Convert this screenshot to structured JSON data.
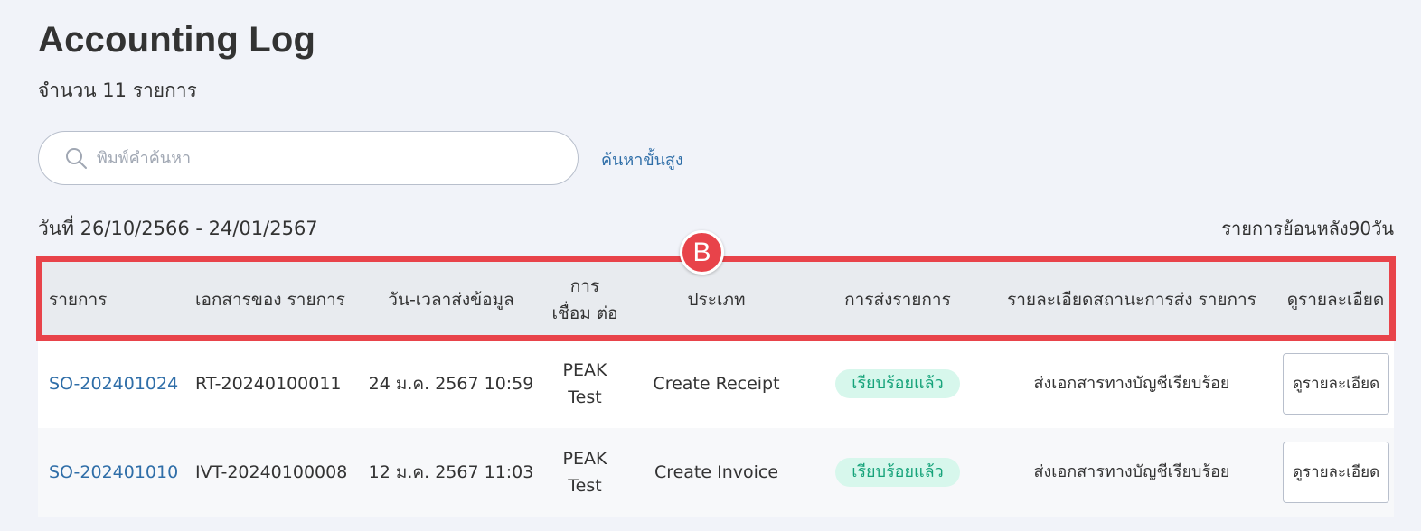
{
  "page": {
    "title": "Accounting Log",
    "count_text": "จำนวน 11 รายการ",
    "search_placeholder": "พิมพ์คำค้นหา",
    "advanced_search": "ค้นหาขั้นสูง",
    "date_range": "วันที่ 26/10/2566 - 24/01/2567",
    "lookback": "รายการย้อนหลัง90วัน"
  },
  "table": {
    "headers": [
      "รายการ",
      "เอกสารของ รายการ",
      "วัน-เวลาส่งข้อมูล",
      "การเชื่อม ต่อ",
      "ประเภท",
      "การส่งรายการ",
      "รายละเอียดสถานะการส่ง รายการ",
      "ดูรายละเอียด"
    ],
    "rows": [
      {
        "order": "SO-202401024",
        "document": "RT-20240100011",
        "datetime": "24 ม.ค. 2567 10:59",
        "connection": "PEAK Test",
        "type": "Create Receipt",
        "status": "เรียบร้อยแล้ว",
        "status_detail": "ส่งเอกสารทางบัญชีเรียบร้อย",
        "action": "ดูรายละเอียด"
      },
      {
        "order": "SO-202401010",
        "document": "IVT-20240100008",
        "datetime": "12 ม.ค. 2567 11:03",
        "connection": "PEAK Test",
        "type": "Create Invoice",
        "status": "เรียบร้อยแล้ว",
        "status_detail": "ส่งเอกสารทางบัญชีเรียบร้อย",
        "action": "ดูรายละเอียด"
      }
    ]
  },
  "annotation": {
    "marker_label": "B",
    "color": "#e8434a"
  },
  "colors": {
    "link": "#2f6ea8",
    "status_bg": "#d7f7ec",
    "status_text": "#16a37a"
  }
}
